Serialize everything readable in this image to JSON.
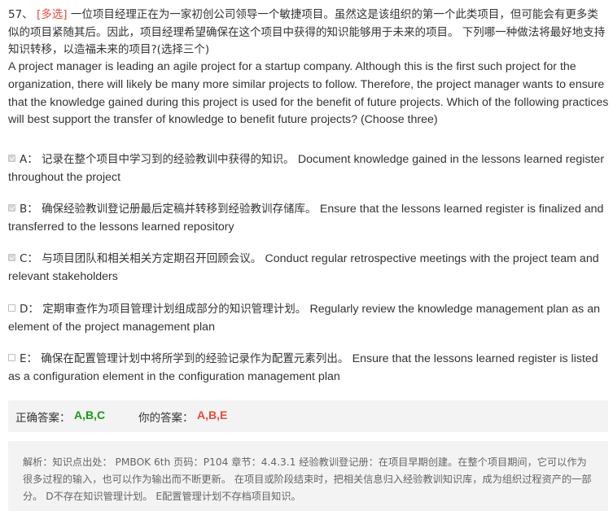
{
  "question": {
    "number": "57、",
    "type_tag": "[多选]",
    "text_cn": "一位项目经理正在为一家初创公司领导一个敏捷项目。虽然这是该组织的第一个此类项目，但可能会有更多类似的项目紧随其后。因此，项目经理希望确保在这个项目中获得的知识能够用于未来的项目。 下列哪一种做法将最好地支持知识转移，以造福未来的项目?(选择三个)",
    "text_en": "A project manager is leading an agile project for a startup company. Although this is the first such project for the organization, there will likely be many more similar projects to follow. Therefore, the project manager wants to ensure that the knowledge gained during this project is used for the benefit of future projects. Which of the following practices will best support the transfer of knowledge to benefit future projects? (Choose three)"
  },
  "options": [
    {
      "letter": "A：",
      "text_cn": "记录在整个项目中学习到的经验教训中获得的知识。",
      "text_en": "Document knowledge gained in the lessons learned register throughout the project",
      "checked": true
    },
    {
      "letter": "B：",
      "text_cn": "确保经验教训登记册最后定稿并转移到经验教训存储库。",
      "text_en": "Ensure that the lessons learned register is finalized and transferred to the lessons learned repository",
      "checked": true
    },
    {
      "letter": "C：",
      "text_cn": "与项目团队和相关相关方定期召开回顾会议。",
      "text_en": "Conduct regular retrospective meetings with the project team and relevant stakeholders",
      "checked": true
    },
    {
      "letter": "D：",
      "text_cn": "定期审查作为项目管理计划组成部分的知识管理计划。",
      "text_en": "Regularly review the knowledge management plan as an element of the project management plan",
      "checked": false
    },
    {
      "letter": "E：",
      "text_cn": "确保在配置管理计划中将所学到的经验记录作为配置元素列出。",
      "text_en": "Ensure that the lessons learned register is listed as a configuration element in the configuration management plan",
      "checked": false
    }
  ],
  "answer": {
    "correct_label": "正确答案：",
    "correct_value": "A,B,C",
    "yours_label": "你的答案：",
    "yours_value": "A,B,E"
  },
  "explanation": {
    "text": "解析：知识点出处： PMBOK 6th 页码：P104 章节：4.4.3.1 经验教训登记册：在项目早期创建。在整个项目期间，它可以作为很多过程的输入，也可以作为输出而不断更新。 在项目或阶段结束时，把相关信息归入经验教训知识库，成为组织过程资产的一部分。 D不存在知识管理计划。 E配置管理计划不存档项目知识。"
  },
  "colors": {
    "tag": "#e74c3c",
    "correct": "#1a9a1a",
    "wrong": "#e74c3c",
    "box_bg": "#f3f3f3"
  }
}
